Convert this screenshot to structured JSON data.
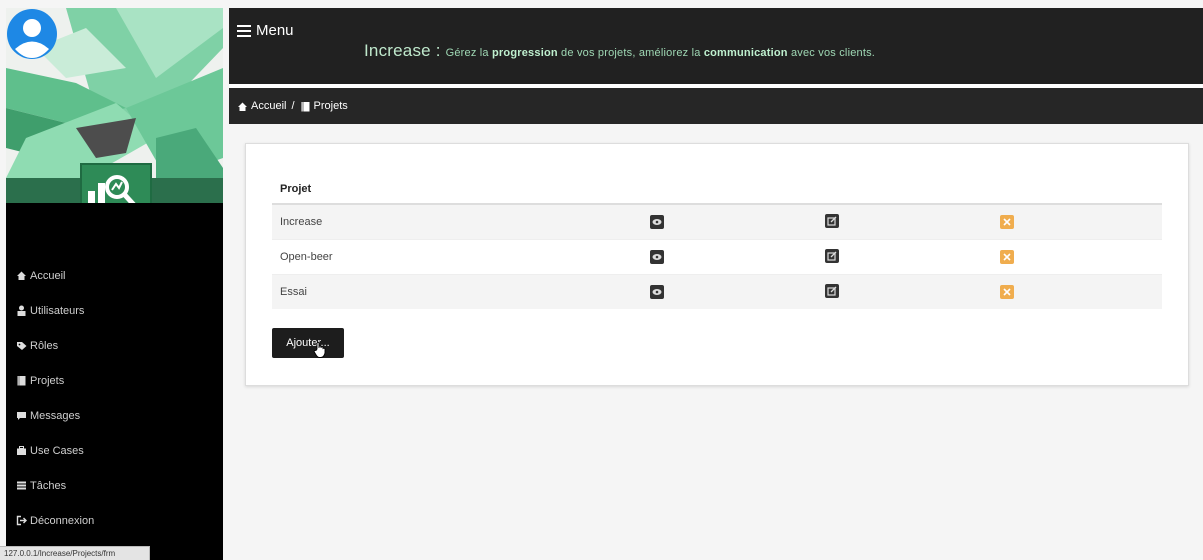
{
  "header": {
    "menu_label": "Menu",
    "tagline": {
      "lead": "Increase : ",
      "p1": "Gérez la ",
      "b1": "progression",
      "p2": " de vos projets, améliorez la ",
      "b2": "communication",
      "p3": " avec vos clients."
    }
  },
  "breadcrumb": {
    "home": "Accueil",
    "separator": "/",
    "current": "Projets"
  },
  "sidebar": {
    "items": [
      {
        "label": "Accueil",
        "icon": "home-icon"
      },
      {
        "label": "Utilisateurs",
        "icon": "user-icon"
      },
      {
        "label": "Rôles",
        "icon": "tag-icon"
      },
      {
        "label": "Projets",
        "icon": "book-icon"
      },
      {
        "label": "Messages",
        "icon": "comment-icon"
      },
      {
        "label": "Use Cases",
        "icon": "briefcase-icon"
      },
      {
        "label": "Tâches",
        "icon": "tasks-icon"
      },
      {
        "label": "Déconnexion",
        "icon": "logout-icon"
      }
    ]
  },
  "projects": {
    "column_header": "Projet",
    "rows": [
      {
        "name": "Increase"
      },
      {
        "name": "Open-beer"
      },
      {
        "name": "Essai"
      }
    ],
    "add_button": "Ajouter..."
  },
  "status": {
    "url": "127.0.0.1/Increase/Projects/frm"
  },
  "colors": {
    "topbar": "#212121",
    "accent_green": "#2e8b57",
    "delete_orange": "#f0ad4e"
  }
}
